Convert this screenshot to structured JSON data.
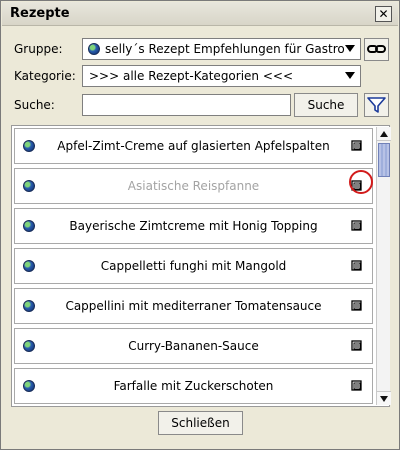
{
  "window": {
    "title": "Rezepte",
    "close_symbol": "✕"
  },
  "form": {
    "group_label": "Gruppe:",
    "group_value": "selly´s  Rezept Empfehlungen für Gastro ...",
    "category_label": "Kategorie:",
    "category_value": ">>> alle Rezept-Kategorien <<<",
    "search_label": "Suche:",
    "search_value": "",
    "search_button": "Suche"
  },
  "recipes": [
    {
      "name": "Apfel-Zimt-Creme auf glasierten Apfelspalten",
      "enabled": true
    },
    {
      "name": "Asiatische Reispfanne",
      "enabled": false,
      "highlighted": true
    },
    {
      "name": "Bayerische Zimtcreme mit Honig Topping",
      "enabled": true
    },
    {
      "name": "Cappelletti funghi mit Mangold",
      "enabled": true
    },
    {
      "name": "Cappellini mit mediterraner Tomatensauce",
      "enabled": true
    },
    {
      "name": "Curry-Bananen-Sauce",
      "enabled": true
    },
    {
      "name": "Farfalle mit Zuckerschoten",
      "enabled": true
    }
  ],
  "footer": {
    "close_button": "Schließen"
  },
  "icons": {
    "globe": "globe-icon",
    "link": "link-icon",
    "filter": "filter-icon",
    "book": "book-icon"
  },
  "colors": {
    "highlight": "#d21b1b",
    "disabled_text": "#a3a3a3"
  }
}
